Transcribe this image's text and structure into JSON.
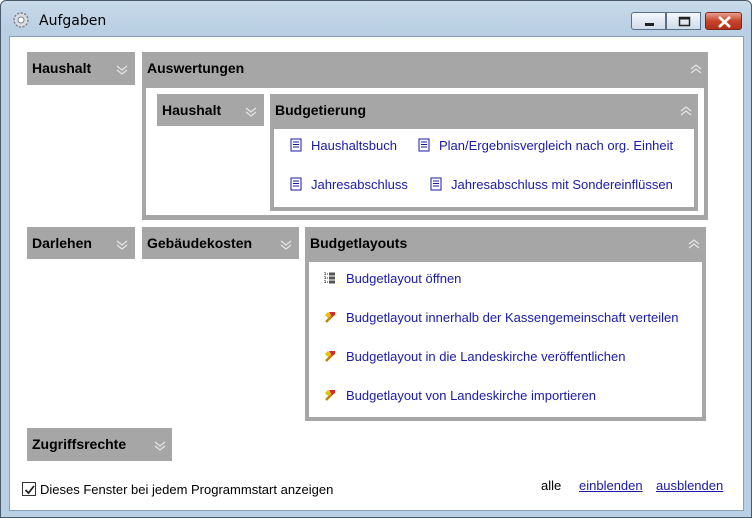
{
  "window": {
    "title": "Aufgaben"
  },
  "panels": {
    "haushalt": "Haushalt",
    "auswertungen": "Auswertungen",
    "haushalt_sub": "Haushalt",
    "budgetierung": "Budgetierung",
    "darlehen": "Darlehen",
    "gebaeudekosten": "Gebäudekosten",
    "budgetlayouts": "Budgetlayouts",
    "zugriffsrechte": "Zugriffsrechte"
  },
  "budgetierung_links": [
    "Haushaltsbuch",
    "Plan/Ergebnisvergleich nach org. Einheit",
    "Jahresabschluss",
    "Jahresabschluss mit Sondereinflüssen"
  ],
  "budgetlayout_links": [
    "Budgetlayout öffnen",
    "Budgetlayout innerhalb der Kassengemeinschaft verteilen",
    "Budgetlayout in die Landeskirche veröffentlichen",
    "Budgetlayout von Landeskirche importieren"
  ],
  "footer": {
    "checkbox_label": "Dieses Fenster bei jedem Programmstart anzeigen",
    "checkbox_checked": true,
    "alle": "alle",
    "einblenden": "einblenden",
    "ausblenden": "ausblenden"
  },
  "colors": {
    "panel": "#a6a6a6",
    "link": "#1a1aa6"
  },
  "icons": {
    "document": "document-icon",
    "tree": "tree-icon",
    "hammer": "hammer-icon"
  }
}
